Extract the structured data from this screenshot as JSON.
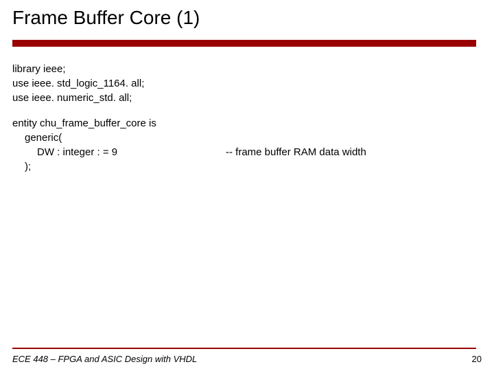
{
  "title": "Frame Buffer Core (1)",
  "code": {
    "line1": "library ieee;",
    "line2": "use ieee. std_logic_1164. all;",
    "line3": "use ieee. numeric_std. all;",
    "line4": "entity chu_frame_buffer_core is",
    "line5": "generic(",
    "line6_left": "DW : integer : = 9",
    "line6_right": "-- frame buffer RAM data width",
    "line7": ");"
  },
  "footer": {
    "course": "ECE 448 – FPGA and ASIC Design with VHDL",
    "page": "20"
  }
}
